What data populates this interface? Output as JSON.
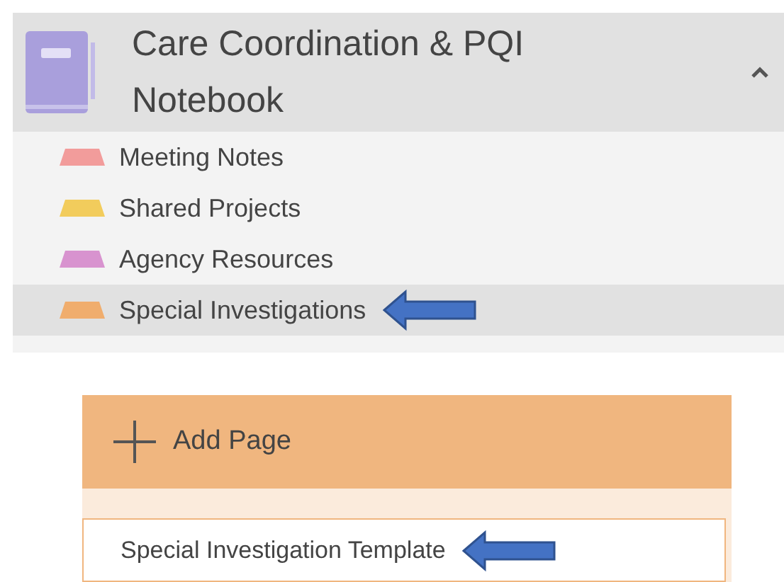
{
  "notebook": {
    "title": "Care Coordination & PQI Notebook",
    "expanded": true
  },
  "sections": [
    {
      "label": "Meeting Notes",
      "color": "#f29c9b",
      "selected": false
    },
    {
      "label": "Shared Projects",
      "color": "#f2cc5c",
      "selected": false
    },
    {
      "label": "Agency Resources",
      "color": "#d893cf",
      "selected": false
    },
    {
      "label": "Special Investigations",
      "color": "#f0ad6d",
      "selected": true
    }
  ],
  "add_page": {
    "label": "Add Page"
  },
  "pages": [
    {
      "title": "Special Investigation Template",
      "selected": true
    }
  ]
}
